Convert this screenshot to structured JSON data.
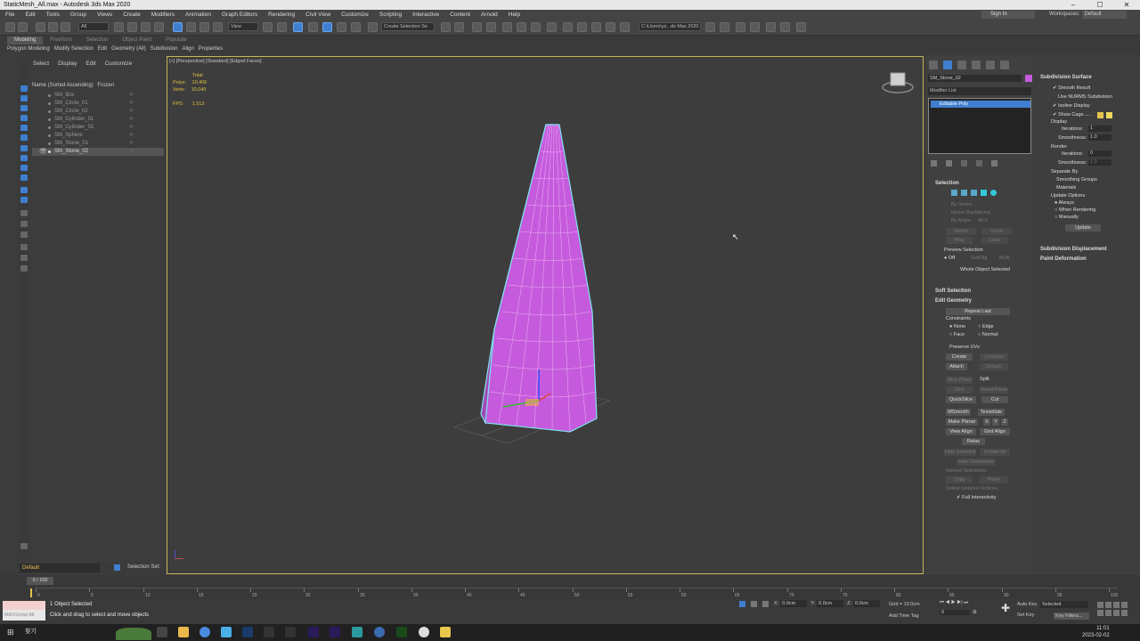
{
  "window": {
    "title": "StaticMesh_All.max - Autodesk 3ds Max 2020"
  },
  "menu": [
    "File",
    "Edit",
    "Tools",
    "Group",
    "Views",
    "Create",
    "Modifiers",
    "Animation",
    "Graph Editors",
    "Rendering",
    "Civil View",
    "Customize",
    "Scripting",
    "Interactive",
    "Content",
    "Arnold",
    "Help"
  ],
  "account": {
    "signin": "Sign In",
    "workspaces_label": "Workspaces:",
    "workspace": "Default"
  },
  "toolbar": {
    "filter": "All",
    "refcoord": "View",
    "named_set": "Create Selection Se",
    "project_path": "C:\\Users\\yz...ds Max 2020"
  },
  "ribbon": {
    "tabs": [
      "Modeling",
      "Freeform",
      "Selection",
      "Object Paint",
      "Populate"
    ],
    "active_tab": "Modeling",
    "sub": [
      "Polygon Modeling",
      "Modify Selection",
      "Edit",
      "Geometry (All)",
      "Subdivision",
      "Align",
      "Properties"
    ]
  },
  "scene_explorer": {
    "tabs": [
      "Select",
      "Display",
      "Edit",
      "Customize"
    ],
    "header_name": "Name (Sorted Ascending)",
    "header_frozen": "Frozen",
    "items": [
      "SM_Box",
      "SM_Circle_01",
      "SM_Circle_02",
      "SM_Cylinder_01",
      "SM_Cylinder_02",
      "SM_Sphere",
      "SM_Stone_01",
      "SM_Stone_02"
    ],
    "selected_item": "SM_Stone_02"
  },
  "layer": {
    "name": "Default",
    "selection_set": "Selection Set:"
  },
  "viewport": {
    "label": "[+] [Perspective] [Standard] [Edged Faces]",
    "stats_total": "Total",
    "polys_label": "Polys:",
    "polys": "10,406",
    "verts_label": "Verts:",
    "verts": "10,040",
    "fps_label": "FPS:",
    "fps": "1.513"
  },
  "command_panel": {
    "object_name": "SM_Stone_02",
    "modifier_list": "Modifier List",
    "stack_item": "Editable Poly",
    "selection": {
      "title": "Selection",
      "by_vertex": "By Vertex",
      "ignore_backfacing": "Ignore Backfacing",
      "by_angle": "By Angle:",
      "angle": "45.0",
      "shrink": "Shrink",
      "grow": "Grow",
      "ring": "Ring",
      "loop": "Loop",
      "preview": "Preview Selection",
      "off": "Off",
      "subobj": "SubObj",
      "multi": "Multi",
      "whole": "Whole Object Selected"
    },
    "soft_selection": "Soft Selection",
    "edit_geometry": {
      "title": "Edit Geometry",
      "repeat_last": "Repeat Last",
      "constraints": "Constraints",
      "none": "None",
      "edge": "Edge",
      "face": "Face",
      "normal": "Normal",
      "preserve_uvs": "Preserve UVs",
      "create": "Create",
      "collapse": "Collapse",
      "attach": "Attach",
      "detach": "Detach",
      "slice_plane": "Slice Plane",
      "split": "Split",
      "slice": "Slice",
      "reset_plane": "Reset Plane",
      "quickslice": "QuickSlice",
      "cut": "Cut",
      "msmooth": "MSmooth",
      "tessellate": "Tessellate",
      "make_planar": "Make Planar",
      "x": "X",
      "y": "Y",
      "z": "Z",
      "view_align": "View Align",
      "grid_align": "Grid Align",
      "relax": "Relax",
      "hide_selected": "Hide Selected",
      "unhide_all": "Unhide All",
      "hide_unselected": "Hide Unselected",
      "named_selections": "Named Selections:",
      "copy": "Copy",
      "paste": "Paste",
      "delete_isolated": "Delete Isolated Vertices",
      "full_interactivity": "Full Interactivity"
    }
  },
  "subdivision": {
    "title": "Subdivision Surface",
    "smooth_result": "Smooth Result",
    "use_nurms": "Use NURMS Subdivision",
    "isoline": "Isoline Display",
    "show_cage": "Show Cage......",
    "display": "Display",
    "iterations_label": "Iterations:",
    "iterations": "1",
    "smoothness_label": "Smoothness:",
    "smoothness": "1.0",
    "render": "Render",
    "r_iterations": "0",
    "r_smoothness": "1.0",
    "separate_by": "Separate By",
    "smoothing_groups": "Smoothing Groups",
    "materials": "Materials",
    "update_options": "Update Options",
    "always": "Always",
    "when_rendering": "When Rendering",
    "manually": "Manually",
    "update": "Update",
    "displacement": "Subdivision Displacement",
    "paint_deformation": "Paint Deformation"
  },
  "timeline": {
    "slider": "0 / 100",
    "ticks": [
      "0",
      "5",
      "10",
      "15",
      "20",
      "25",
      "30",
      "35",
      "40",
      "45",
      "50",
      "55",
      "60",
      "65",
      "70",
      "75",
      "80",
      "85",
      "90",
      "95",
      "100"
    ]
  },
  "status": {
    "maxscript": "MAXScript Mi",
    "selected": "1 Object Selected",
    "prompt": "Click and drag to select and move objects",
    "x_label": "X:",
    "x": "0.0cm",
    "y_label": "Y:",
    "y": "0.0cm",
    "z_label": "Z:",
    "z": "0.0cm",
    "grid": "Grid = 10.0cm",
    "add_time_tag": "Add Time Tag",
    "autokey": "Auto Key",
    "selected_mode": "Selected",
    "setkey": "Set Key",
    "key_filters": "Key Filters...",
    "frame": "0"
  },
  "taskbar": {
    "search": "찾기",
    "time": "11:01",
    "date": "2023-02-02"
  },
  "colors": {
    "accent": "#3f7fd0",
    "mesh": "#c55bdc",
    "wire": "#7fe3f0",
    "viewport_border": "#c9b45a",
    "stats": "#e0c23c"
  }
}
